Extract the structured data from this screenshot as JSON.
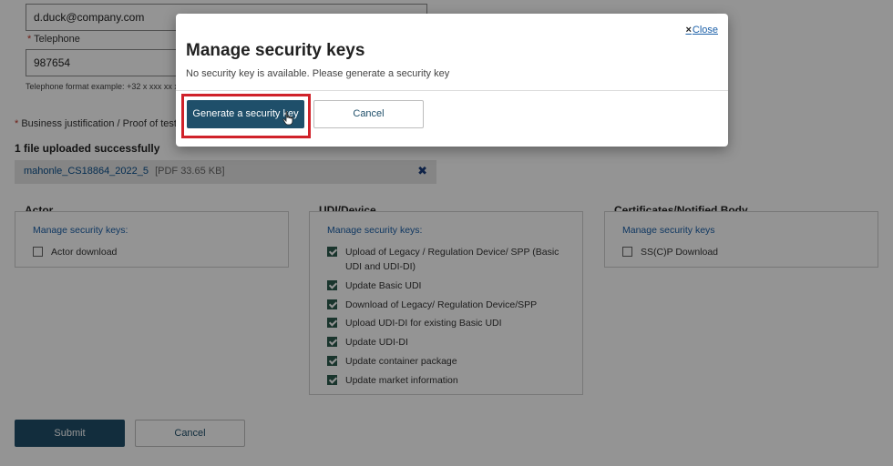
{
  "form": {
    "email_value": "d.duck@company.com",
    "telephone_label": "Telephone",
    "telephone_value": "987654",
    "telephone_hint": "Telephone format example: +32 x xxx xx x",
    "business_justification_label": "Business justification / Proof of test",
    "upload_status": "1 file uploaded successfully",
    "file": {
      "name": "mahonle_CS18864_2022_5",
      "meta": "[PDF 33.65 KB]"
    }
  },
  "panels": {
    "actor": {
      "title": "Actor",
      "link": "Manage security keys:",
      "items": [
        {
          "label": "Actor download",
          "checked": false
        }
      ]
    },
    "udi": {
      "title": "UDI/Device",
      "link": "Manage security keys:",
      "items": [
        {
          "label": "Upload of Legacy / Regulation Device/ SPP (Basic UDI and UDI-DI)",
          "checked": true
        },
        {
          "label": "Update Basic UDI",
          "checked": true
        },
        {
          "label": "Download of Legacy/ Regulation Device/SPP",
          "checked": true
        },
        {
          "label": "Upload UDI-DI for existing Basic UDI",
          "checked": true
        },
        {
          "label": "Update UDI-DI",
          "checked": true
        },
        {
          "label": "Update container package",
          "checked": true
        },
        {
          "label": "Update market information",
          "checked": true
        }
      ]
    },
    "certificates": {
      "title": "Certificates/Notified Body",
      "link": "Manage security keys",
      "items": [
        {
          "label": "SS(C)P Download",
          "checked": false
        }
      ]
    }
  },
  "actions": {
    "submit_label": "Submit",
    "cancel_label": "Cancel"
  },
  "modal": {
    "title": "Manage security keys",
    "subtitle": "No security key is available. Please generate a security key",
    "close_label": "Close",
    "generate_label": "Generate a security key",
    "cancel_label": "Cancel"
  },
  "colors": {
    "primary": "#1f4f6a",
    "link": "#1a5fa8",
    "highlight": "#d0222a",
    "checkbox_checked": "#2e5c4f"
  }
}
